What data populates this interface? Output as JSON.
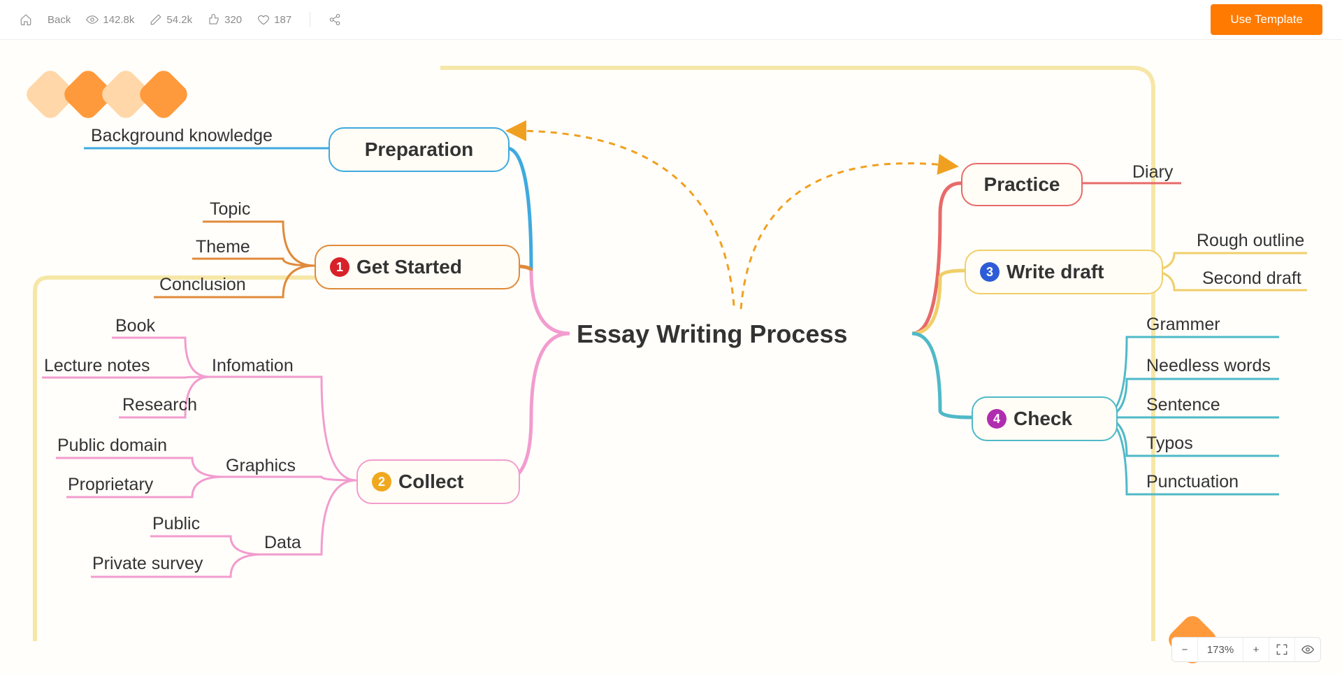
{
  "toolbar": {
    "back": "Back",
    "views": "142.8k",
    "edits": "54.2k",
    "likes": "320",
    "favs": "187",
    "use_template": "Use Template"
  },
  "zoom": {
    "value": "173%",
    "minus": "−",
    "plus": "+"
  },
  "map": {
    "center": "Essay Writing Process",
    "preparation": {
      "title": "Preparation",
      "children": [
        "Background knowledge"
      ]
    },
    "get_started": {
      "num": "1",
      "title": "Get Started",
      "children": [
        "Topic",
        "Theme",
        "Conclusion"
      ]
    },
    "collect": {
      "num": "2",
      "title": "Collect",
      "information": {
        "title": "Infomation",
        "children": [
          "Book",
          "Lecture notes",
          "Research"
        ]
      },
      "graphics": {
        "title": "Graphics",
        "children": [
          "Public domain",
          "Proprietary"
        ]
      },
      "data": {
        "title": "Data",
        "children": [
          "Public",
          "Private survey"
        ]
      }
    },
    "practice": {
      "title": "Practice",
      "children": [
        "Diary"
      ]
    },
    "write_draft": {
      "num": "3",
      "title": "Write draft",
      "children": [
        "Rough outline",
        "Second draft"
      ]
    },
    "check": {
      "num": "4",
      "title": "Check",
      "children": [
        "Grammer",
        "Needless words",
        "Sentence",
        "Typos",
        "Punctuation"
      ]
    }
  },
  "colors": {
    "blue": "#3fa9e0",
    "orange": "#e08a3a",
    "pink": "#f29ccf",
    "red": "#e86a6a",
    "yellow": "#f0cf6a",
    "teal": "#4fb9c8",
    "badge_red": "#d8222a",
    "badge_yellow": "#f0a81e",
    "badge_blue": "#2e5cd8",
    "badge_purple": "#b02db0"
  }
}
